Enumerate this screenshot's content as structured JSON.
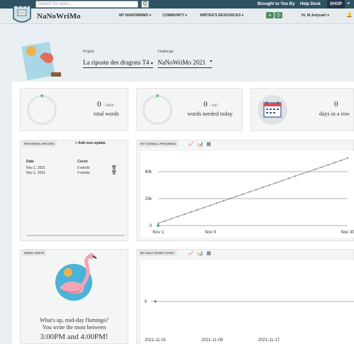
{
  "topbar": {
    "search_placeholder": "Search for users...",
    "search_btn": "Q",
    "brought": "Brought to You By",
    "help": "Help Desk",
    "shop": "SHOP"
  },
  "nav": {
    "brand": "NaNoWriMo",
    "items": [
      "MY NANOWRIMO",
      "COMMUNITY",
      "WRITER'S RESOURCES"
    ],
    "greeting": "Hi, M.Jedynak!",
    "add": "+"
  },
  "project": {
    "project_label": "Project",
    "project_value": "La riposte des dragons T4",
    "challenge_label": "Challenge",
    "challenge_value": "NaNoWriMo 2021"
  },
  "stats": {
    "total_num": "0",
    "total_goal": "/ 50000",
    "total_label": "total words",
    "today_num": "0",
    "today_goal": "/ 1667",
    "today_label": "words needed today",
    "days_num": "0",
    "days_label": "days in a row"
  },
  "progress": {
    "title": "PROGRESS UPDATES",
    "add_label": "+ Add new update",
    "col_date": "Date",
    "col_count": "Count",
    "rows": [
      {
        "date": "Nov 1, 2021",
        "count": "0 words"
      },
      {
        "date": "Nov 1, 2021",
        "count": "0 words"
      }
    ]
  },
  "overall": {
    "title": "MY OVERALL PROGRESS"
  },
  "when": {
    "title": "WHEN I WRITE",
    "line1": "What's up, mid-day flamingo?",
    "line2": "You write the most between",
    "line3": "3:00PM and 4:00PM!"
  },
  "daily": {
    "title": "MY DAILY WORD COUNT"
  },
  "colors": {
    "topbar": "#2f5363",
    "accent": "#4d8b67",
    "shop": "#21344a",
    "line": "#8a8a8a",
    "ring_dot": "#6fc17b",
    "highlight": "#e8a040"
  },
  "chart_data": [
    {
      "type": "line",
      "title": "MY OVERALL PROGRESS",
      "y_ticks": [
        "0",
        "20k",
        "40k"
      ],
      "x_ticks": [
        "Nov 1",
        "Nov 9",
        "Nov 30"
      ],
      "ylim": [
        0,
        50000
      ],
      "grid": true,
      "series": [
        {
          "x": [
            1,
            2,
            3,
            4,
            5,
            6,
            7,
            8,
            9,
            10,
            11,
            12,
            13,
            14,
            15,
            16,
            17,
            18,
            19,
            20,
            21,
            22,
            23,
            24,
            25,
            26,
            27,
            28,
            29,
            30
          ],
          "values": [
            1667,
            3333,
            5000,
            6667,
            8333,
            10000,
            11667,
            13333,
            15000,
            16667,
            18333,
            20000,
            21667,
            23333,
            25000,
            26667,
            28333,
            30000,
            31667,
            33333,
            35000,
            36667,
            38333,
            40000,
            41667,
            43333,
            45000,
            46667,
            48333,
            50000
          ]
        },
        {
          "x": [
            1
          ],
          "values": [
            0
          ]
        }
      ]
    },
    {
      "type": "line",
      "title": "MY DAILY WORD COUNT",
      "y_ticks": [
        "0"
      ],
      "x_ticks": [
        "2021-11-01",
        "2021-11-09",
        "2021-11-17"
      ],
      "grid": true,
      "series": [
        {
          "x": [
            1
          ],
          "values": [
            0
          ]
        }
      ]
    }
  ]
}
